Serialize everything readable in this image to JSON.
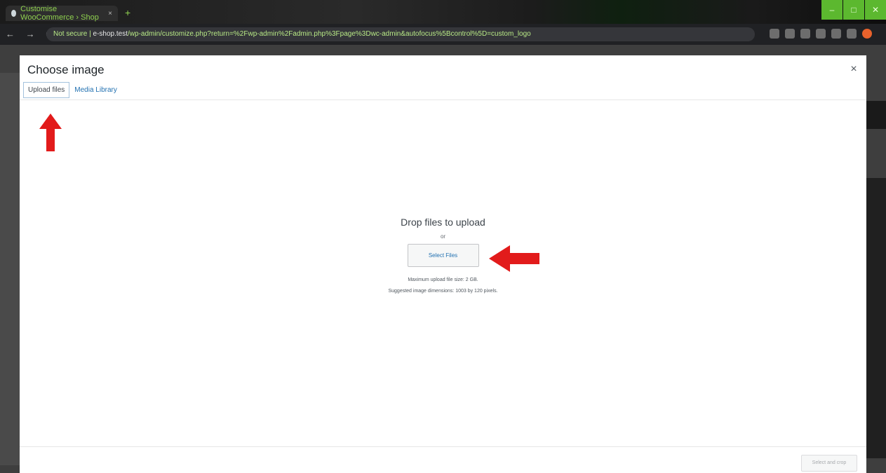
{
  "browser": {
    "tab_title": "Customise WooCommerce › Shop",
    "tab_close": "×",
    "new_tab": "+",
    "window_controls": [
      "–",
      "□",
      "✕"
    ],
    "nav_buttons": "← → C",
    "url_host": "e-shop.test",
    "url_prefix": "Not secure | ",
    "url_rest": "/wp-admin/customize.php?return=%2Fwp-admin%2Fadmin.php%3Fpage%3Dwc-admin&autofocus%5Bcontrol%5D=custom_logo"
  },
  "modal": {
    "title": "Choose image",
    "close_label": "×",
    "tabs": [
      {
        "label": "Upload files",
        "active": true
      },
      {
        "label": "Media Library",
        "active": false
      }
    ],
    "uploader": {
      "heading": "Drop files to upload",
      "or_text": "or",
      "select_button": "Select Files",
      "max_size": "Maximum upload file size: 2 GB.",
      "suggested": "Suggested image dimensions: 1003 by 120 pixels."
    },
    "footer_button": "Select and crop"
  },
  "annotations": {
    "color": "#e21b1b"
  }
}
